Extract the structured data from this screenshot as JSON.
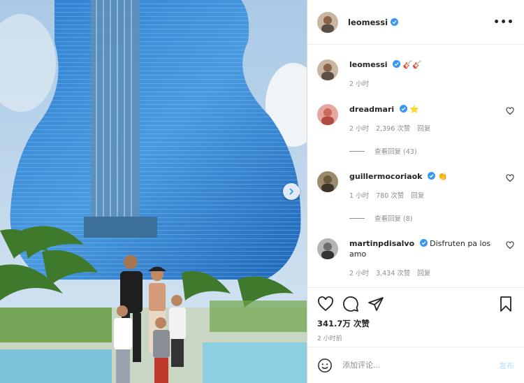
{
  "post": {
    "username": "leomessi",
    "more_icon": "more-horizontal-icon",
    "caption_user": "leomessi",
    "caption_emoji": "🎸🎸",
    "caption_time": "2 小时",
    "like_count": "341.7万 次赞",
    "time_ago": "2 小时前"
  },
  "comments": [
    {
      "user": "dreadmari",
      "text": "⭐",
      "time": "2 小时",
      "likes": "2,396 次赞",
      "reply": "回复",
      "view_replies": "查看回复 (43)"
    },
    {
      "user": "guillermocoriaok",
      "text": "👏",
      "time": "1 小时",
      "likes": "780 次赞",
      "reply": "回复",
      "view_replies": "查看回复 (8)"
    },
    {
      "user": "martinpdisalvo",
      "text": "Disfruten pa los amo",
      "time": "2 小时",
      "likes": "3,434 次赞",
      "reply": "回复"
    }
  ],
  "composer": {
    "placeholder": "添加评论...",
    "post_label": "发布"
  },
  "colors": {
    "verified": "#3897f0",
    "post_disabled": "#b2dffc",
    "meta": "#8e8e8e"
  }
}
